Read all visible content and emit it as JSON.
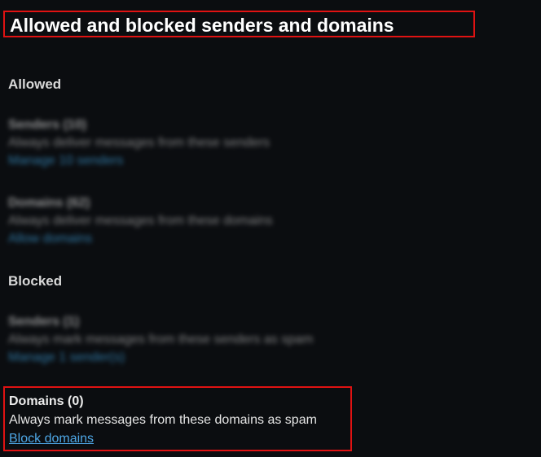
{
  "page": {
    "title": "Allowed and blocked senders and domains"
  },
  "allowed": {
    "heading": "Allowed",
    "senders": {
      "title": "Senders (10)",
      "description": "Always deliver messages from these senders",
      "link": "Manage 10 senders"
    },
    "domains": {
      "title": "Domains (62)",
      "description": "Always deliver messages from these domains",
      "link": "Allow domains"
    }
  },
  "blocked": {
    "heading": "Blocked",
    "senders": {
      "title": "Senders (1)",
      "description": "Always mark messages from these senders as spam",
      "link": "Manage 1 sender(s)"
    },
    "domains": {
      "title": "Domains (0)",
      "description": "Always mark messages from these domains as spam",
      "link": "Block domains"
    }
  }
}
